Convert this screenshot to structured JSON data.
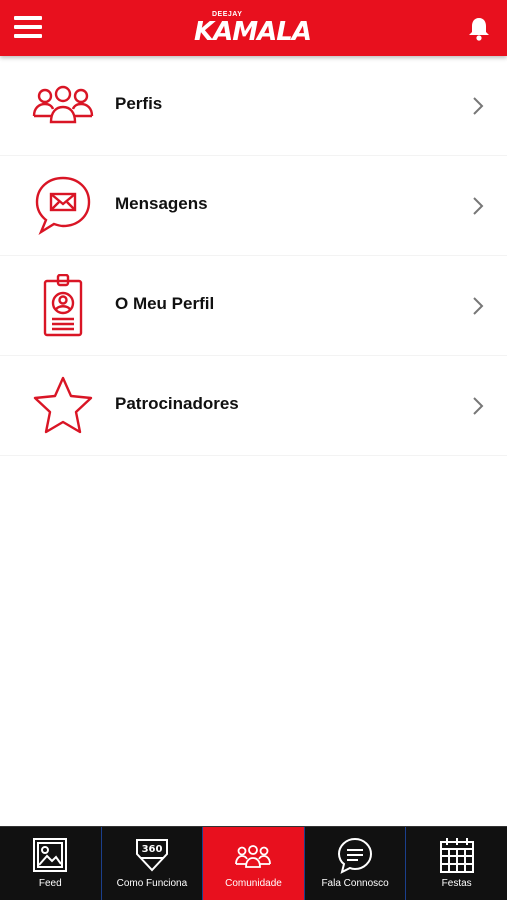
{
  "header": {
    "logo_small": "DEEJAY",
    "logo_main": "KAMALA",
    "menu_icon": "hamburger-menu-icon",
    "bell_icon": "bell-icon"
  },
  "menu": {
    "items": [
      {
        "label": "Perfis",
        "icon": "group-icon"
      },
      {
        "label": "Mensagens",
        "icon": "message-bubble-icon"
      },
      {
        "label": "O Meu Perfil",
        "icon": "id-badge-icon"
      },
      {
        "label": "Patrocinadores",
        "icon": "star-icon"
      }
    ]
  },
  "bottom_nav": {
    "items": [
      {
        "label": "Feed",
        "icon": "image-icon"
      },
      {
        "label": "Como Funciona",
        "icon": "360-icon"
      },
      {
        "label": "Comunidade",
        "icon": "group-icon",
        "active": true
      },
      {
        "label": "Fala Connosco",
        "icon": "chat-bubble-icon"
      },
      {
        "label": "Festas",
        "icon": "calendar-icon"
      }
    ]
  },
  "colors": {
    "brand_red": "#e8101e",
    "nav_background": "#111111",
    "nav_divider": "#1b3f8c"
  }
}
